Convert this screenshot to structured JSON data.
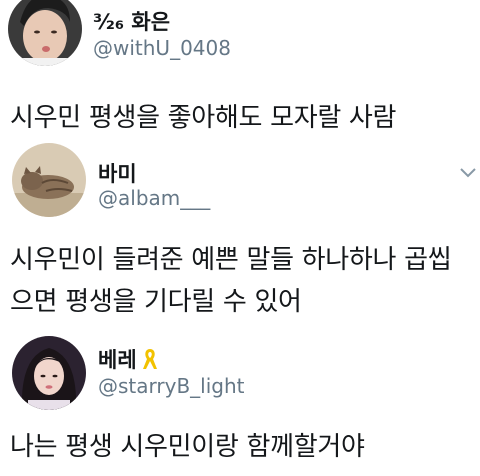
{
  "tweets": [
    {
      "name": "³⁄₂₆ 화은",
      "handle": "@withU_0408",
      "text": [
        "시우민 평생을 좋아해도 모자랄 사람"
      ]
    },
    {
      "name": "바미",
      "handle": "@albam___",
      "text": [
        "시우민이 들려준 예쁜 말들 하나하나 곱씹",
        "으면 평생을 기다릴 수 있어"
      ],
      "menu_icon": "chevron-down-icon"
    },
    {
      "name": "베레",
      "handle": "@starryB_light",
      "text": [
        "나는 평생 시우민이랑 함께할거야"
      ],
      "badge_icon": "yellow-ribbon-icon"
    }
  ],
  "colors": {
    "text": "#14171a",
    "handle": "#657786",
    "chevron": "#8899a6",
    "ribbon": "#f2c200"
  }
}
